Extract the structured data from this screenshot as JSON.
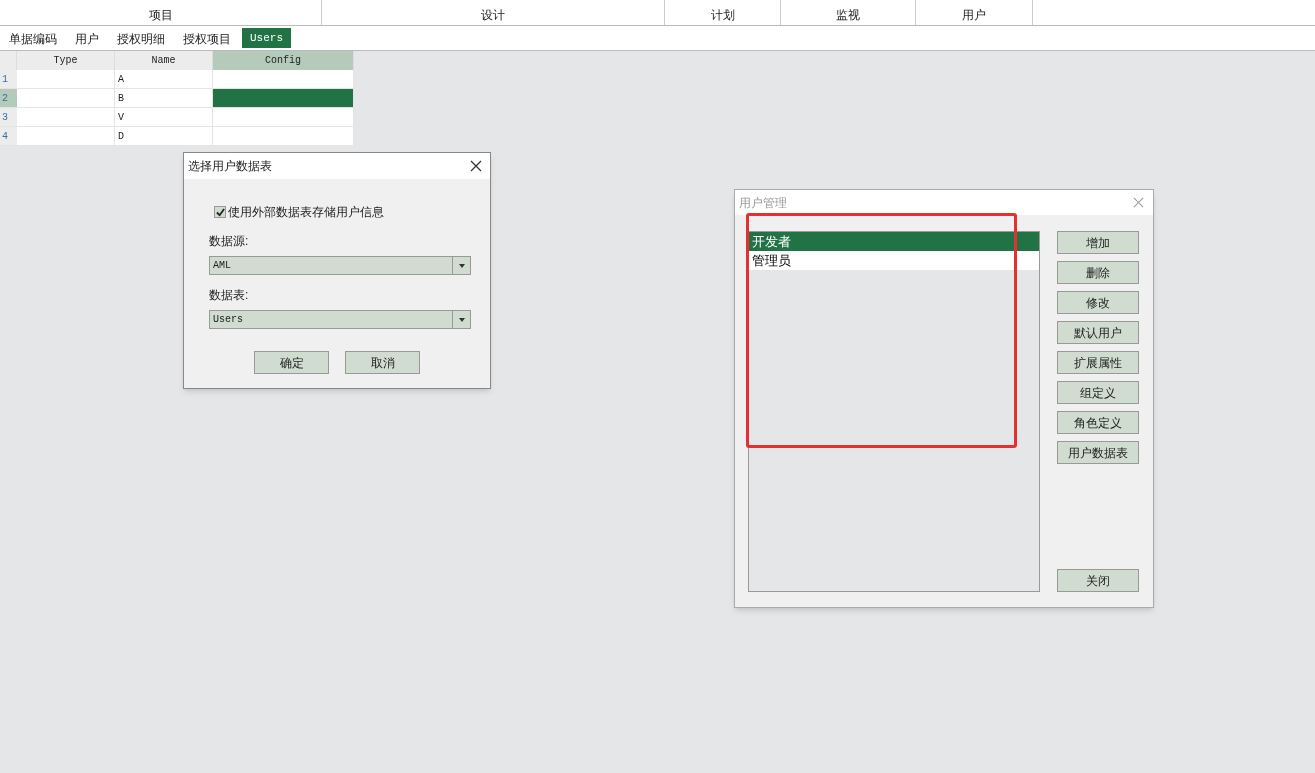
{
  "ribbon_groups": [
    {
      "label": "项目"
    },
    {
      "label": "设计"
    },
    {
      "label": "计划"
    },
    {
      "label": "监视"
    },
    {
      "label": "用户"
    }
  ],
  "tabs": [
    {
      "label": "单据编码",
      "selected": false
    },
    {
      "label": "用户",
      "selected": false
    },
    {
      "label": "授权明细",
      "selected": false
    },
    {
      "label": "授权项目",
      "selected": false
    },
    {
      "label": "Users",
      "selected": true
    }
  ],
  "table": {
    "columns": [
      {
        "label": "Type",
        "selected": false
      },
      {
        "label": "Name",
        "selected": false
      },
      {
        "label": "Config",
        "selected": true
      }
    ],
    "rows": [
      {
        "number": "1",
        "cells": [
          "",
          "A",
          ""
        ],
        "selected": false
      },
      {
        "number": "2",
        "cells": [
          "",
          "B",
          ""
        ],
        "selected": true
      },
      {
        "number": "3",
        "cells": [
          "",
          "V",
          ""
        ],
        "selected": false
      },
      {
        "number": "4",
        "cells": [
          "",
          "D",
          ""
        ],
        "selected": false
      }
    ]
  },
  "select_dialog": {
    "title": "选择用户数据表",
    "checkbox": {
      "label": "使用外部数据表存储用户信息",
      "checked": true
    },
    "fields": [
      {
        "label": "数据源:",
        "value": "AML"
      },
      {
        "label": "数据表:",
        "value": "Users"
      }
    ],
    "buttons": [
      "确定",
      "取消"
    ]
  },
  "user_dialog": {
    "title": "用户管理",
    "users": [
      {
        "label": "开发者",
        "selected": true
      },
      {
        "label": "管理员",
        "selected": false
      }
    ],
    "buttons": [
      "增加",
      "删除",
      "修改",
      "默认用户",
      "扩展属性",
      "组定义",
      "角色定义",
      "用户数据表"
    ],
    "close_button": "关闭"
  }
}
